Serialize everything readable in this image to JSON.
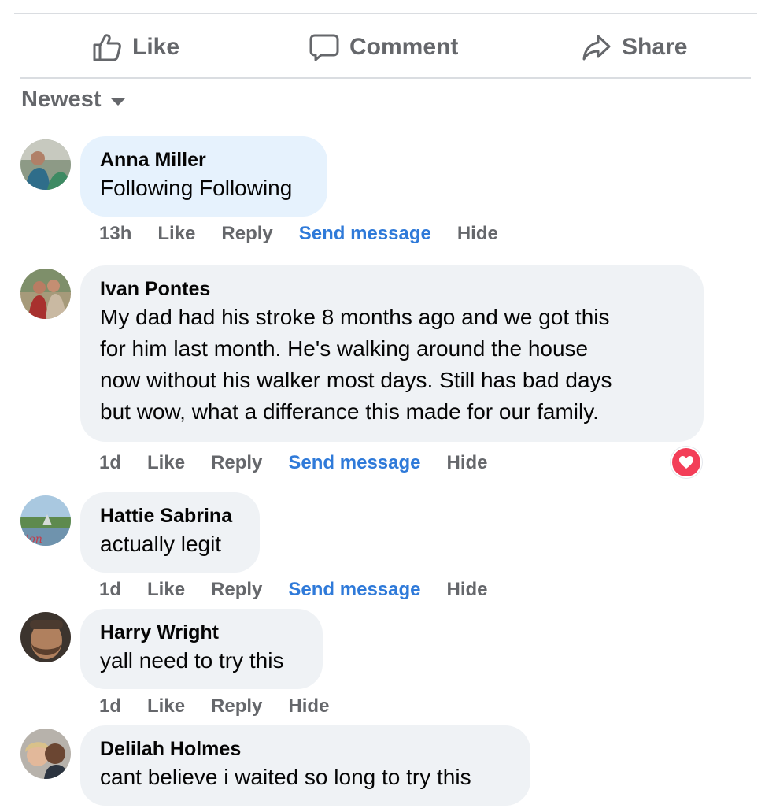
{
  "actions": {
    "like": "Like",
    "comment": "Comment",
    "share": "Share"
  },
  "sort": {
    "label": "Newest"
  },
  "comments": [
    {
      "author": "Anna Miller",
      "lines": [
        "Following Following"
      ],
      "time": "13h",
      "like": "Like",
      "reply": "Reply",
      "send": "Send message",
      "hide": "Hide"
    },
    {
      "author": "Ivan Pontes",
      "lines": [
        "My dad had his stroke 8 months ago and we got this",
        "for him last month. He's walking around the house",
        "now without his walker most days. Still has bad days",
        "but wow, what a differance this made for our family."
      ],
      "time": "1d",
      "like": "Like",
      "reply": "Reply",
      "send": "Send message",
      "hide": "Hide",
      "reaction": "love"
    },
    {
      "author": "Hattie Sabrina",
      "lines": [
        "actually legit"
      ],
      "time": "1d",
      "like": "Like",
      "reply": "Reply",
      "send": "Send message",
      "hide": "Hide"
    },
    {
      "author": "Harry Wright",
      "lines": [
        "yall need to try this"
      ],
      "time": "1d",
      "like": "Like",
      "reply": "Reply",
      "hide": "Hide"
    },
    {
      "author": "Delilah Holmes",
      "lines": [
        "cant believe i waited so long to try this"
      ]
    }
  ],
  "colors": {
    "link": "#2f7ad9",
    "muted": "#65676b",
    "bubble": "#eff2f5",
    "bubble_highlight": "#e6f2fd",
    "love": "#f33e58"
  }
}
